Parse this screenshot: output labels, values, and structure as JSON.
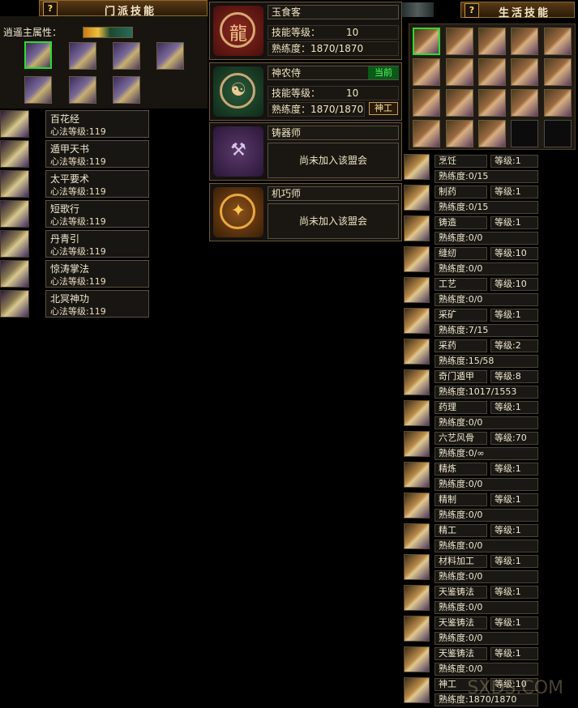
{
  "school_panel": {
    "help_label": "?",
    "title": "门派技能",
    "attr_label": "逍遥主属性："
  },
  "life_panel": {
    "help_label": "?",
    "title": "生活技能"
  },
  "school_skills": [
    {
      "name": "百花经",
      "level": "心法等级:119"
    },
    {
      "name": "遁甲天书",
      "level": "心法等级:119"
    },
    {
      "name": "太平要术",
      "level": "心法等级:119"
    },
    {
      "name": "短歌行",
      "level": "心法等级:119"
    },
    {
      "name": "丹青引",
      "level": "心法等级:119"
    },
    {
      "name": "惊涛掌法",
      "level": "心法等级:119"
    },
    {
      "name": "北冥神功",
      "level": "心法等级:119"
    }
  ],
  "alliances": [
    {
      "name": "玉食客",
      "skill_label": "技能等级：",
      "skill_value": "10",
      "prof_label": "熟练度：",
      "prof_value": "1870/1870",
      "emblem": "dragon-emblem-icon",
      "color": "#6a1a18"
    },
    {
      "name": "神农侍",
      "skill_label": "技能等级：",
      "skill_value": "10",
      "prof_label": "熟练度：",
      "prof_value": "1870/1870",
      "current": "当前",
      "action": "神工",
      "emblem": "yin-yang-emblem-icon",
      "color": "#1a3a24"
    },
    {
      "name": "铸器师",
      "status": "尚未加入该盟会",
      "emblem": "forge-emblem-icon",
      "color": "#4a2a5a"
    },
    {
      "name": "机巧师",
      "status": "尚未加入该盟会",
      "emblem": "mechanism-emblem-icon",
      "color": "#6a3a10"
    }
  ],
  "life_skills": [
    {
      "name": "烹饪",
      "level": "等级:1",
      "prof": "熟练度:0/15"
    },
    {
      "name": "制药",
      "level": "等级:1",
      "prof": "熟练度:0/15"
    },
    {
      "name": "铸造",
      "level": "等级:1",
      "prof": "熟练度:0/0"
    },
    {
      "name": "缝纫",
      "level": "等级:10",
      "prof": "熟练度:0/0"
    },
    {
      "name": "工艺",
      "level": "等级:10",
      "prof": "熟练度:0/0"
    },
    {
      "name": "采矿",
      "level": "等级:1",
      "prof": "熟练度:7/15"
    },
    {
      "name": "采药",
      "level": "等级:2",
      "prof": "熟练度:15/58"
    },
    {
      "name": "奇门遁甲",
      "level": "等级:8",
      "prof": "熟练度:1017/1553"
    },
    {
      "name": "药理",
      "level": "等级:1",
      "prof": "熟练度:0/0"
    },
    {
      "name": "六艺风骨",
      "level": "等级:70",
      "prof": "熟练度:0/∞"
    },
    {
      "name": "精炼",
      "level": "等级:1",
      "prof": "熟练度:0/0"
    },
    {
      "name": "精制",
      "level": "等级:1",
      "prof": "熟练度:0/0"
    },
    {
      "name": "精工",
      "level": "等级:1",
      "prof": "熟练度:0/0"
    },
    {
      "name": "材料加工",
      "level": "等级:1",
      "prof": "熟练度:0/0"
    },
    {
      "name": "天鉴铸法",
      "level": "等级:1",
      "prof": "熟练度:0/0"
    },
    {
      "name": "天鉴铸法",
      "level": "等级:1",
      "prof": "熟练度:0/0"
    },
    {
      "name": "天鉴铸法",
      "level": "等级:1",
      "prof": "熟练度:0/0"
    },
    {
      "name": "神工",
      "level": "等级:10",
      "prof": "熟练度:1870/1870"
    }
  ],
  "watermark": "SXDS.COM"
}
